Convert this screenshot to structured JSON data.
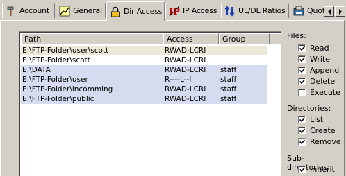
{
  "tabs": [
    {
      "label": "Account",
      "icon": "hammer-icon",
      "active": false
    },
    {
      "label": "General",
      "icon": "chart-icon",
      "active": false
    },
    {
      "label": "Dir Access",
      "icon": "padlock-icon",
      "active": true
    },
    {
      "label": "IP Access",
      "icon": "ip-icon",
      "active": false
    },
    {
      "label": "UL/DL Ratios",
      "icon": "updown-arrows-icon",
      "active": false
    },
    {
      "label": "Quota",
      "icon": "quota-icon",
      "active": false
    }
  ],
  "columns": {
    "path": "Path",
    "access": "Access",
    "group": "Group"
  },
  "rows": [
    {
      "path": "E:\\FTP-Folder\\user\\scott",
      "access": "RWAD-LCRI",
      "group": "",
      "highlight": "#ece9d8"
    },
    {
      "path": "E:\\FTP-Folder\\scott",
      "access": "RWAD-LCRI",
      "group": "",
      "highlight": "#ffffff"
    },
    {
      "path": "E:\\DATA",
      "access": "RWAD-LCRI",
      "group": "staff",
      "highlight": "#d6dcf0"
    },
    {
      "path": "E:\\FTP-Folder\\user",
      "access": "R----L--I",
      "group": "staff",
      "highlight": "#d6dcf0"
    },
    {
      "path": "E:\\FTP-Folder\\incomming",
      "access": "RWAD-LCRI",
      "group": "staff",
      "highlight": "#d6dcf0"
    },
    {
      "path": "E:\\FTP-Folder\\public",
      "access": "RWAD-LCRI",
      "group": "staff",
      "highlight": "#d6dcf0"
    }
  ],
  "files": {
    "heading": "Files:",
    "options": [
      {
        "label": "Read",
        "checked": true
      },
      {
        "label": "Write",
        "checked": true
      },
      {
        "label": "Append",
        "checked": true
      },
      {
        "label": "Delete",
        "checked": true
      },
      {
        "label": "Execute",
        "checked": false
      }
    ]
  },
  "directories": {
    "heading": "Directories:",
    "options": [
      {
        "label": "List",
        "checked": true
      },
      {
        "label": "Create",
        "checked": true
      },
      {
        "label": "Remove",
        "checked": true
      }
    ]
  },
  "subdirectories": {
    "heading": "Sub-directories:",
    "options": [
      {
        "label": "Inherit",
        "checked": true
      }
    ]
  }
}
